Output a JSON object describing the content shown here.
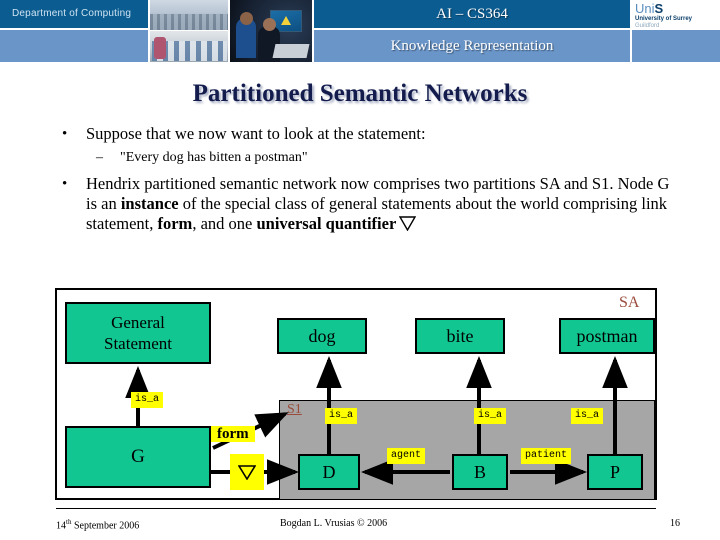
{
  "header": {
    "department": "Department of Computing",
    "course_title": "AI – CS364",
    "course_subtitle": "Knowledge Representation",
    "logo_uni": "Uni",
    "logo_s": "S",
    "logo_name": "University of Surrey",
    "logo_place": "Guildford",
    "colors": {
      "dark_blue": "#0b5c91",
      "light_blue": "#6a95c8"
    }
  },
  "slide": {
    "title": "Partitioned Semantic Networks",
    "bullets": [
      {
        "level": 1,
        "marker": "•",
        "text": "Suppose that we now want to look at the statement:"
      },
      {
        "level": 2,
        "marker": "–",
        "text": "\"Every dog has bitten a postman\""
      },
      {
        "level": 1,
        "marker": "•",
        "text_parts": [
          {
            "text": "Hendrix partitioned semantic network now comprises two partitions SA and S1.  Node G is an ",
            "bold": false
          },
          {
            "text": "instance",
            "bold": true
          },
          {
            "text": " of the special class of general statements about the world comprising link statement, ",
            "bold": false
          },
          {
            "text": "form",
            "bold": true
          },
          {
            "text": ", and one ",
            "bold": false
          },
          {
            "text": "universal quantifier",
            "bold": true
          }
        ],
        "trailing_symbol": "∀"
      }
    ]
  },
  "diagram": {
    "partition_outer_label": "SA",
    "partition_inner_label": "S1",
    "partition_label_color": "#9b4b3c",
    "node_fill": "#12c691",
    "label_fill": "#ffff00",
    "partition_fill": "#a6a6a6",
    "nodes": [
      {
        "id": "general",
        "label": "General\nStatement",
        "line1": "General",
        "line2": "Statement"
      },
      {
        "id": "g",
        "label": "G"
      },
      {
        "id": "dog",
        "label": "dog"
      },
      {
        "id": "bite",
        "label": "bite"
      },
      {
        "id": "postman",
        "label": "postman"
      },
      {
        "id": "d",
        "label": "D"
      },
      {
        "id": "b",
        "label": "B"
      },
      {
        "id": "p",
        "label": "P"
      }
    ],
    "edges": [
      {
        "from": "g",
        "to": "general",
        "label": "is_a"
      },
      {
        "from": "g",
        "to": "s1",
        "label": "form"
      },
      {
        "from": "g",
        "to": "d",
        "label": "∀"
      },
      {
        "from": "d",
        "to": "dog",
        "label": "is_a"
      },
      {
        "from": "b",
        "to": "bite",
        "label": "is_a"
      },
      {
        "from": "p",
        "to": "postman",
        "label": "is_a"
      },
      {
        "from": "b",
        "to": "d",
        "label": "agent"
      },
      {
        "from": "b",
        "to": "p",
        "label": "patient"
      }
    ],
    "edge_labels": {
      "isa_general": "is_a",
      "isa_dog": "is_a",
      "isa_bite": "is_a",
      "isa_postman": "is_a",
      "agent": "agent",
      "patient": "patient",
      "form": "form",
      "forall": "∀"
    }
  },
  "footer": {
    "date_num": "14",
    "date_sup": "th",
    "date_rest": " September 2006",
    "author": "Bogdan L. Vrusias © 2006",
    "page": "16"
  }
}
